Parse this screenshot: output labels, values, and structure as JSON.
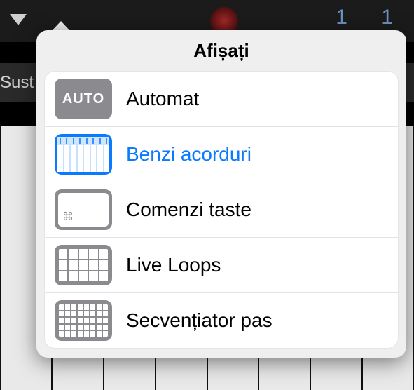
{
  "background": {
    "sustain_label": "Sust",
    "counter": "1  1"
  },
  "popover": {
    "title": "Afișați",
    "items": [
      {
        "id": "automat",
        "label": "Automat",
        "icon": "auto-icon",
        "icon_text": "AUTO",
        "selected": false
      },
      {
        "id": "chord-strips",
        "label": "Benzi acorduri",
        "icon": "chord-strips-icon",
        "icon_text": "",
        "selected": true
      },
      {
        "id": "key-commands",
        "label": "Comenzi taste",
        "icon": "key-commands-icon",
        "icon_text": "⌘",
        "selected": false
      },
      {
        "id": "live-loops",
        "label": "Live Loops",
        "icon": "live-loops-icon",
        "icon_text": "",
        "selected": false
      },
      {
        "id": "step-sequencer",
        "label": "Secvențiator pas",
        "icon": "step-seq-icon",
        "icon_text": "",
        "selected": false
      }
    ]
  }
}
